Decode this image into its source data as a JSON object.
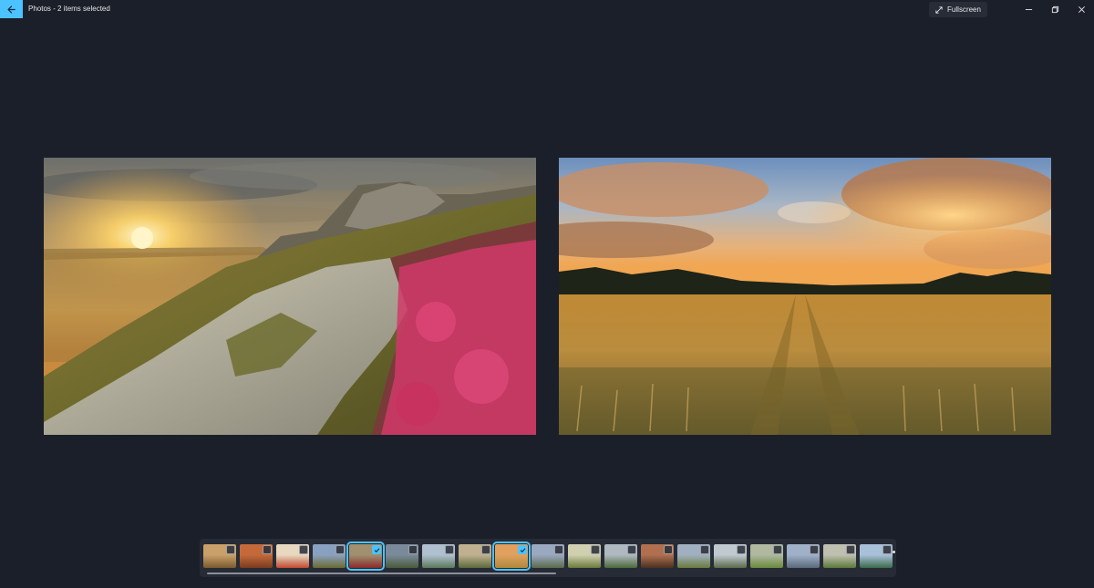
{
  "window": {
    "title": "Photos - 2 items selected",
    "fullscreen_label": "Fullscreen"
  },
  "colors": {
    "accent": "#4cc2ff",
    "background": "#1b1f29"
  },
  "photos": [
    {
      "name": "moorland-sunset-heather",
      "description": "sunset over moorland hill with rock tor and pink heather"
    },
    {
      "name": "wheat-field-sunset",
      "description": "golden wheat field with tractor lines under sunset sky"
    }
  ],
  "filmstrip": {
    "items": [
      {
        "selected": false
      },
      {
        "selected": false
      },
      {
        "selected": false
      },
      {
        "selected": false
      },
      {
        "selected": true
      },
      {
        "selected": false
      },
      {
        "selected": false
      },
      {
        "selected": false
      },
      {
        "selected": true
      },
      {
        "selected": false
      },
      {
        "selected": false
      },
      {
        "selected": false
      },
      {
        "selected": false
      },
      {
        "selected": false
      },
      {
        "selected": false
      },
      {
        "selected": false
      },
      {
        "selected": false
      },
      {
        "selected": false
      },
      {
        "selected": false
      }
    ],
    "scroll_fraction": 0.51
  }
}
